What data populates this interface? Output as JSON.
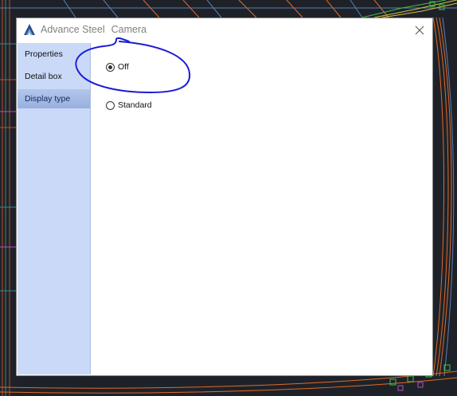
{
  "window": {
    "app_name": "Advance Steel",
    "title": "Camera",
    "icon": "advance-steel-logo-icon",
    "close_icon": "close-icon"
  },
  "sidebar": {
    "items": [
      {
        "label": "Properties",
        "active": false
      },
      {
        "label": "Detail box",
        "active": false
      },
      {
        "label": "Display type",
        "active": true
      }
    ]
  },
  "display_type": {
    "options": [
      {
        "label": "Off",
        "checked": true
      },
      {
        "label": "Standard",
        "checked": false
      }
    ]
  },
  "colors": {
    "cad_background": "#1e2228",
    "sidebar_bg": "#c9d9f7",
    "sidebar_active": "#9fb6e1",
    "annotation_ink": "#1b1bd6"
  }
}
